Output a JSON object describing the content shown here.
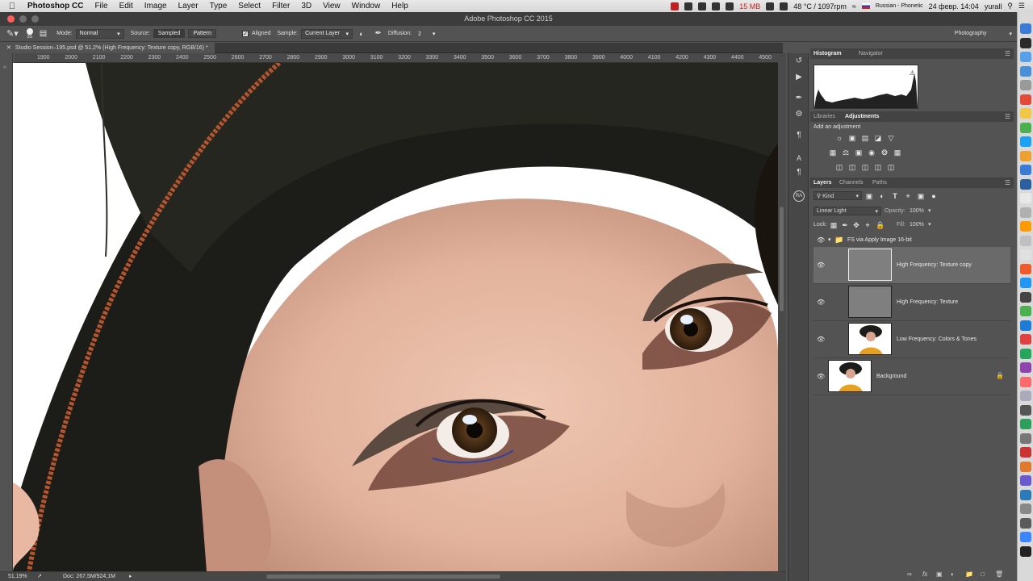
{
  "menubar": {
    "app_name": "Photoshop CC",
    "items": [
      "File",
      "Edit",
      "Image",
      "Layer",
      "Type",
      "Select",
      "Filter",
      "3D",
      "View",
      "Window",
      "Help"
    ],
    "memory": "15 MB",
    "temp": "48 °C / 1097rpm",
    "input_source": "Russian - Phonetic",
    "datetime": "24 февр. 14:04",
    "user": "yurall"
  },
  "window": {
    "title": "Adobe Photoshop CC 2015"
  },
  "options": {
    "brush_size": "35",
    "mode_label": "Mode:",
    "mode_value": "Normal",
    "source_label": "Source:",
    "source_sampled": "Sampled",
    "source_pattern": "Pattern",
    "aligned_label": "Aligned",
    "sample_label": "Sample:",
    "sample_value": "Current Layer",
    "diffusion_label": "Diffusion:",
    "diffusion_value": "2",
    "workspace": "Photography"
  },
  "document": {
    "tab_title": "Studio Session–195.psd @ 51,2% (High Frequency: Texture copy, RGB/16) *",
    "zoom": "51,19%",
    "doc_info": "Doc: 267,5M/924,1M"
  },
  "ruler_labels": [
    "1900",
    "2000",
    "2100",
    "2200",
    "2300",
    "2400",
    "2500",
    "2600",
    "2700",
    "2800",
    "2900",
    "3000",
    "3100",
    "3200",
    "3300",
    "3400",
    "3500",
    "3600",
    "3700",
    "3800",
    "3900",
    "4000",
    "4100",
    "4200",
    "4300",
    "4400",
    "4500"
  ],
  "panels": {
    "histogram_tab": "Histogram",
    "navigator_tab": "Navigator",
    "libraries_tab": "Libraries",
    "adjustments_tab": "Adjustments",
    "add_adjustment": "Add an adjustment",
    "layers_tab": "Layers",
    "channels_tab": "Channels",
    "paths_tab": "Paths",
    "kind_filter": "Kind",
    "blend_mode": "Linear Light",
    "opacity_label": "Opacity:",
    "opacity_value": "100%",
    "lock_label": "Lock:",
    "fill_label": "Fill:",
    "fill_value": "100%"
  },
  "layers": [
    {
      "name": "FS via Apply Image 16-bit",
      "type": "group"
    },
    {
      "name": "High Frequency: Texture copy",
      "type": "gray",
      "selected": true
    },
    {
      "name": "High Frequency: Texture",
      "type": "gray"
    },
    {
      "name": "Low Frequency: Colors & Tones",
      "type": "photo"
    },
    {
      "name": "Background",
      "type": "photo",
      "locked": true
    }
  ],
  "colors": {
    "ps_dark": "#535353",
    "selected_layer": "#6a6a6a",
    "memory_red": "#d02020"
  }
}
